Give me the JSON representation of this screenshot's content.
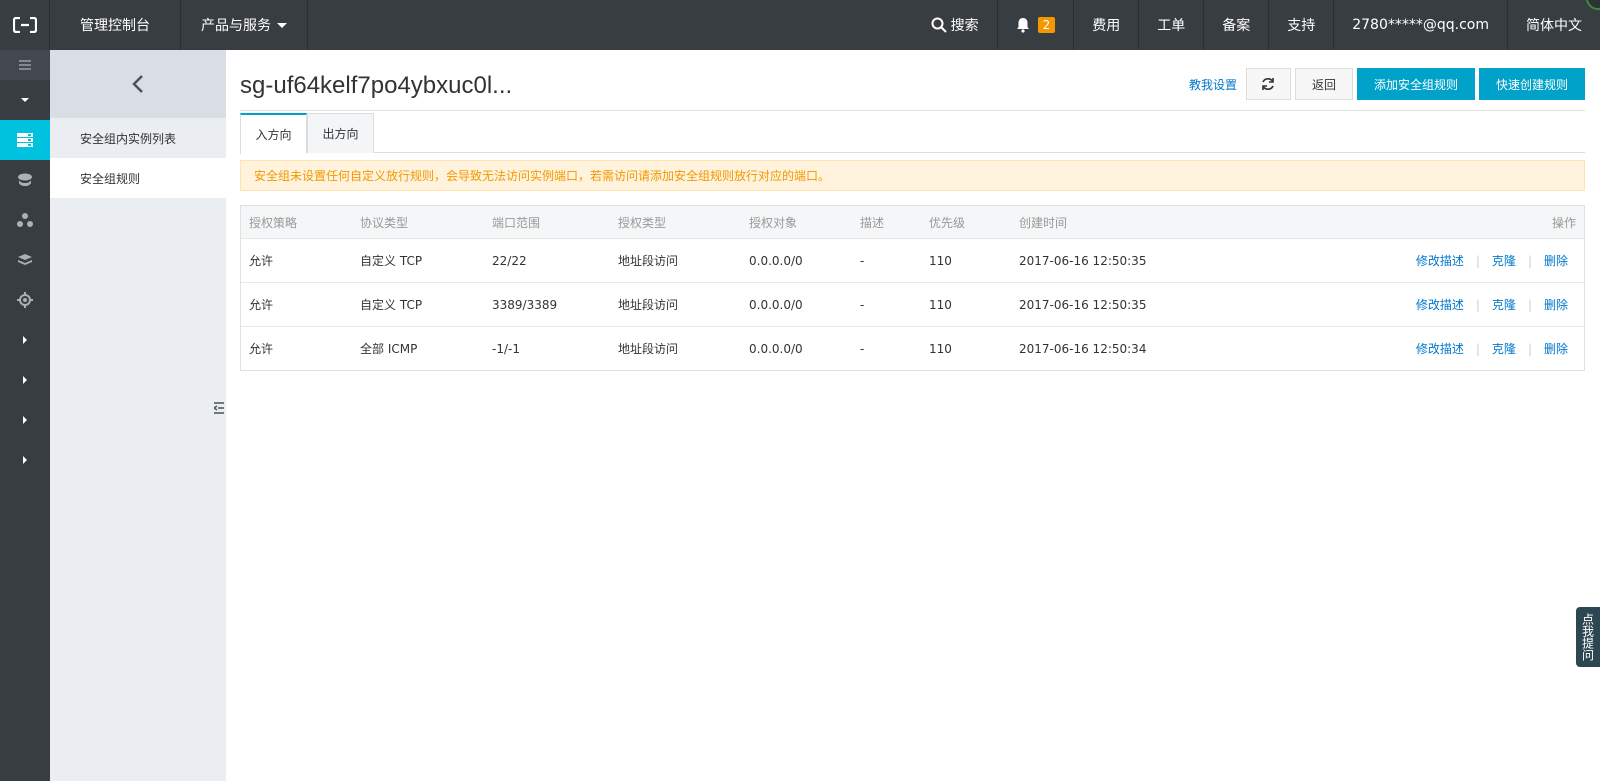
{
  "topbar": {
    "console": "管理控制台",
    "products": "产品与服务",
    "search": "搜索",
    "notification_count": "2",
    "billing": "费用",
    "tickets": "工单",
    "icp": "备案",
    "support": "支持",
    "account": "2780*****@qq.com",
    "language": "简体中文"
  },
  "sidebar": {
    "items": [
      {
        "label": "安全组内实例列表"
      },
      {
        "label": "安全组规则"
      }
    ]
  },
  "page": {
    "title": "sg-uf64kelf7po4ybxuc0l...",
    "help_link": "教我设置",
    "back_button": "返回",
    "add_rule_button": "添加安全组规则",
    "quick_rule_button": "快速创建规则"
  },
  "tabs": [
    {
      "label": "入方向"
    },
    {
      "label": "出方向"
    }
  ],
  "alert": "安全组未设置任何自定义放行规则，会导致无法访问实例端口，若需访问请添加安全组规则放行对应的端口。",
  "table": {
    "headers": [
      "授权策略",
      "协议类型",
      "端口范围",
      "授权类型",
      "授权对象",
      "描述",
      "优先级",
      "创建时间",
      "操作"
    ],
    "rows": [
      {
        "policy": "允许",
        "protocol": "自定义 TCP",
        "port": "22/22",
        "auth_type": "地址段访问",
        "target": "0.0.0.0/0",
        "desc": "-",
        "priority": "110",
        "created": "2017-06-16 12:50:35"
      },
      {
        "policy": "允许",
        "protocol": "自定义 TCP",
        "port": "3389/3389",
        "auth_type": "地址段访问",
        "target": "0.0.0.0/0",
        "desc": "-",
        "priority": "110",
        "created": "2017-06-16 12:50:35"
      },
      {
        "policy": "允许",
        "protocol": "全部 ICMP",
        "port": "-1/-1",
        "auth_type": "地址段访问",
        "target": "0.0.0.0/0",
        "desc": "-",
        "priority": "110",
        "created": "2017-06-16 12:50:34"
      }
    ],
    "ops": {
      "edit": "修改描述",
      "clone": "克隆",
      "delete": "删除"
    }
  },
  "float_help": "点我提问",
  "colors": {
    "topbar": "#373d41",
    "accent": "#00c1de",
    "primary": "#00a2ca",
    "link": "#0077cc",
    "warning": "#f39800"
  }
}
